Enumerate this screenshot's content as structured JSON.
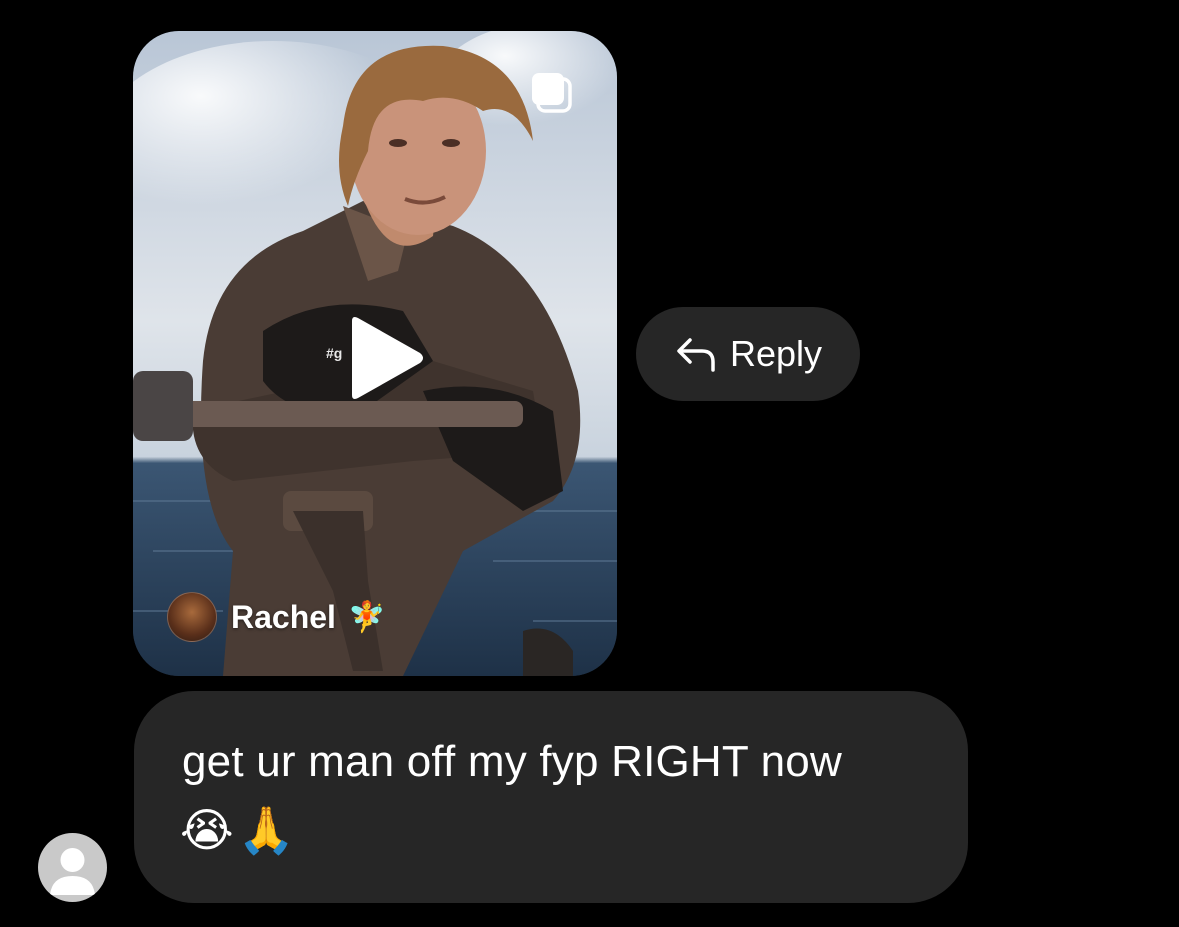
{
  "shared_post": {
    "hashtag": "#g",
    "author_name": "Rachel",
    "author_emoji": "🧚",
    "icons": [
      "multiple-media-icon",
      "play-icon"
    ]
  },
  "reply": {
    "label": "Reply",
    "icon": "reply-arrow-icon"
  },
  "message": {
    "text": "get ur man off my fyp RIGHT now",
    "emoji": "😭🙏"
  },
  "colors": {
    "background": "#000000",
    "bubble": "#262626",
    "text": "#ffffff",
    "avatar_placeholder": "#c9c9c9"
  }
}
